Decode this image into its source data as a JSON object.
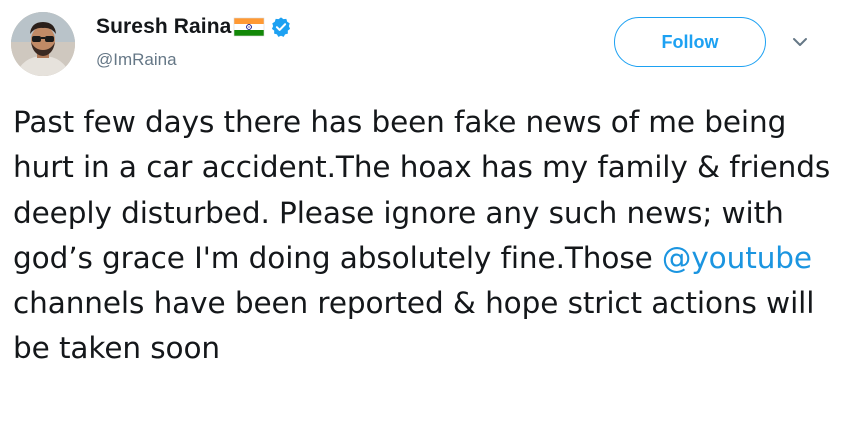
{
  "user": {
    "display_name": "Suresh Raina",
    "handle": "@ImRaina",
    "verified": true,
    "flag": "india-flag-icon",
    "avatar": "avatar-photo"
  },
  "actions": {
    "follow_label": "Follow",
    "menu_icon": "chevron-down-icon"
  },
  "tweet": {
    "text_part1": "Past few days there has been fake news of me being hurt in a car accident.The hoax has my family & friends deeply disturbed. Please ignore any such news; with god’s grace I'm doing absolutely fine.Those ",
    "mention": "@youtube",
    "text_part2": " channels have been reported & hope strict actions will be taken soon"
  },
  "colors": {
    "accent": "#1da1f2",
    "mention": "#1b95e0",
    "text": "#14171a",
    "muted": "#657786"
  }
}
